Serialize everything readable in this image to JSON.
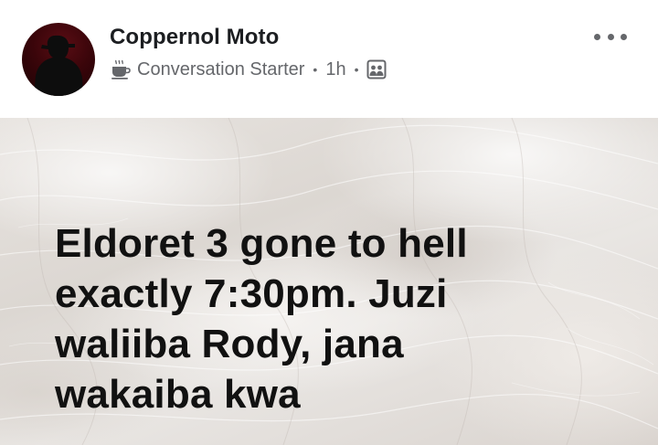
{
  "post": {
    "author": "Coppernol Moto",
    "badge": {
      "icon": "coffee-cup-icon",
      "label": "Conversation Starter"
    },
    "separator": "•",
    "time": "1h",
    "audience_icon": "group-icon",
    "more_icon": "more-options-icon",
    "text": "Eldoret 3 gone to hell\nexactly 7:30pm. Juzi\nwaliiba Rody, jana\nwakaiba kwa"
  },
  "colors": {
    "author_text": "#1c1e21",
    "meta_text": "#65676b",
    "post_text": "#111111"
  }
}
